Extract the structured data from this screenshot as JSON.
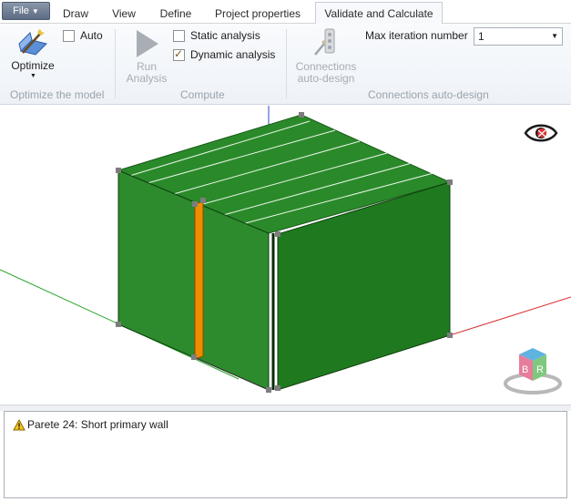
{
  "menu": {
    "file_label": "File",
    "tabs": [
      {
        "label": "Draw",
        "active": false
      },
      {
        "label": "View",
        "active": false
      },
      {
        "label": "Define",
        "active": false
      },
      {
        "label": "Project properties",
        "active": false
      },
      {
        "label": "Validate and Calculate",
        "active": true
      }
    ]
  },
  "ribbon": {
    "optimize_group": {
      "label": "Optimize the model",
      "optimize_button": "Optimize",
      "auto_label": "Auto",
      "auto_checked": false
    },
    "compute_group": {
      "label": "Compute",
      "run_line1": "Run",
      "run_line2": "Analysis",
      "static_label": "Static analysis",
      "static_checked": false,
      "dynamic_label": "Dynamic analysis",
      "dynamic_checked": true
    },
    "connections_group": {
      "label": "Connections auto-design",
      "button_line1": "Connections",
      "button_line2": "auto-design",
      "max_iter_label": "Max iteration number",
      "max_iter_value": "1"
    }
  },
  "viewport": {
    "navcube_letters": [
      "B",
      "R"
    ],
    "colors": {
      "wall": "#2d8b2d",
      "wall_side": "#1f7a1f",
      "roof": "#2a8a2a",
      "highlight_wall": "#f08c00",
      "node": "#7d7d7d",
      "axis_x": "#d93030",
      "axis_y": "#22a022",
      "axis_z": "#2d48c8"
    }
  },
  "messages": [
    {
      "icon": "warning-icon",
      "text": "Parete 24: Short primary wall"
    }
  ]
}
